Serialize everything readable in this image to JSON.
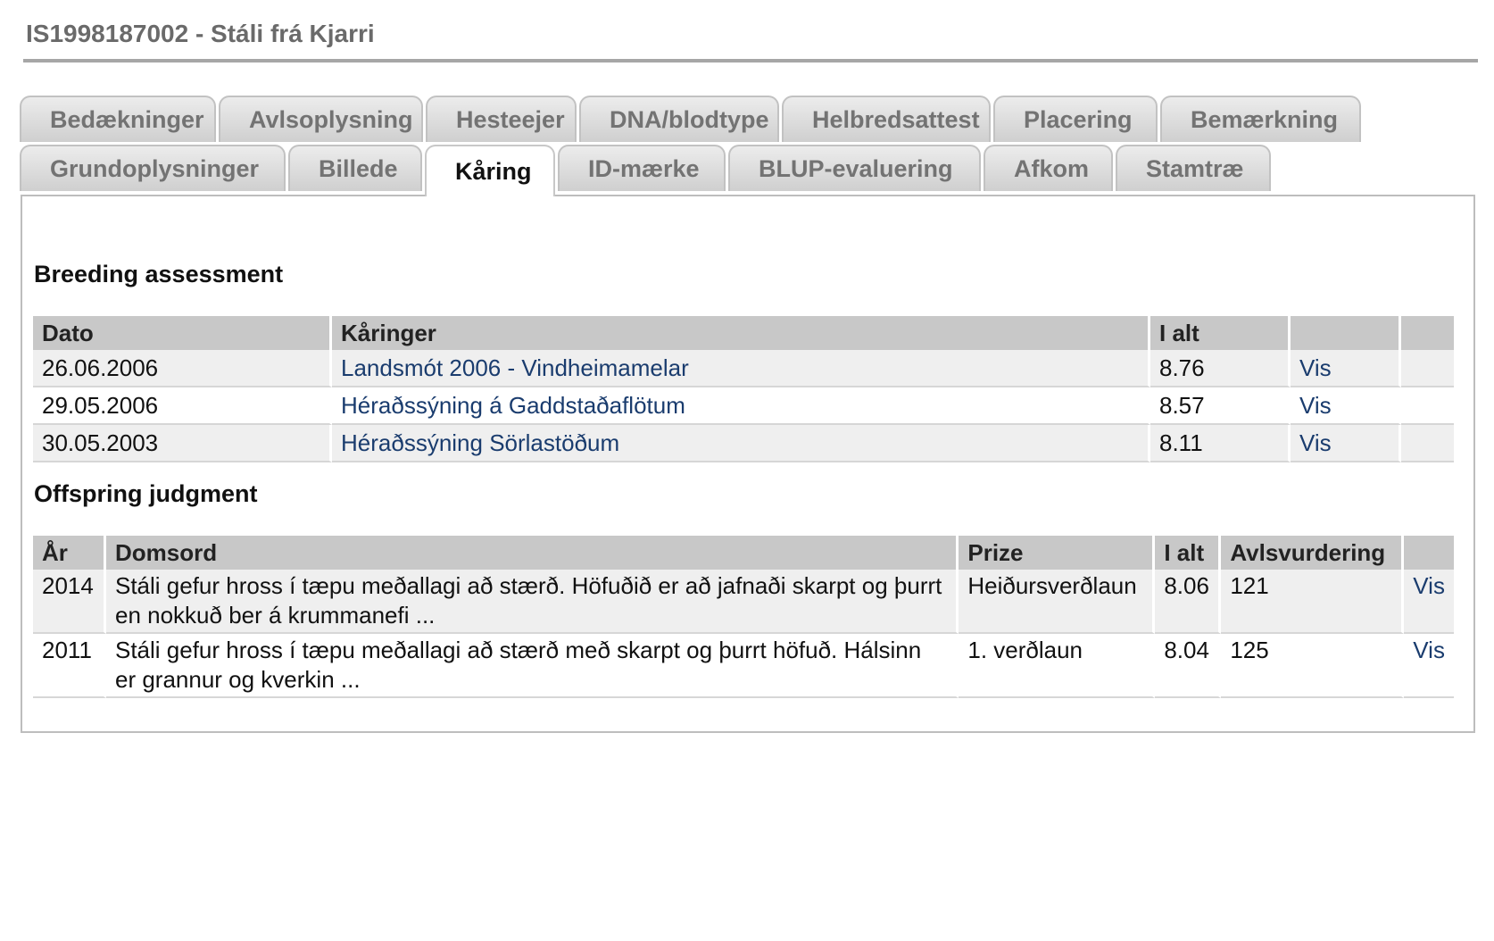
{
  "page": {
    "title": "IS1998187002 - Stáli frá Kjarri"
  },
  "tabs": {
    "row1": [
      "Bedækninger",
      "Avlsoplysning",
      "Hesteejer",
      "DNA/blodtype",
      "Helbredsattest",
      "Placering",
      "Bemærkning"
    ],
    "row2": [
      "Grundoplysninger",
      "Billede",
      "Kåring",
      "ID-mærke",
      "BLUP-evaluering",
      "Afkom",
      "Stamtræ"
    ],
    "active": "Kåring"
  },
  "breeding": {
    "heading": "Breeding assessment",
    "headers": [
      "Dato",
      "Kåringer",
      "I alt",
      "",
      ""
    ],
    "rows": [
      {
        "date": "26.06.2006",
        "show": "Landsmót 2006 - Vindheimamelar",
        "total": "8.76",
        "link": "Vis"
      },
      {
        "date": "29.05.2006",
        "show": "Héraðssýning á Gaddstaðaflötum",
        "total": "8.57",
        "link": "Vis"
      },
      {
        "date": "30.05.2003",
        "show": "Héraðssýning Sörlastöðum",
        "total": "8.11",
        "link": "Vis"
      }
    ]
  },
  "offspring": {
    "heading": "Offspring judgment",
    "headers": [
      "År",
      "Domsord",
      "Prize",
      "I alt",
      "Avlsvurdering",
      ""
    ],
    "rows": [
      {
        "year": "2014",
        "text": "Stáli gefur hross í tæpu meðallagi að stærð. Höfuðið er að jafnaði skarpt og þurrt en nokkuð ber á krummanefi ...",
        "prize": "Heiðursverðlaun",
        "total": "8.06",
        "score": "121",
        "link": "Vis"
      },
      {
        "year": "2011",
        "text": "Stáli gefur hross í tæpu meðallagi að stærð með skarpt og þurrt höfuð. Hálsinn er grannur og kverkin ...",
        "prize": "1. verðlaun",
        "total": "8.04",
        "score": "125",
        "link": "Vis"
      }
    ]
  }
}
